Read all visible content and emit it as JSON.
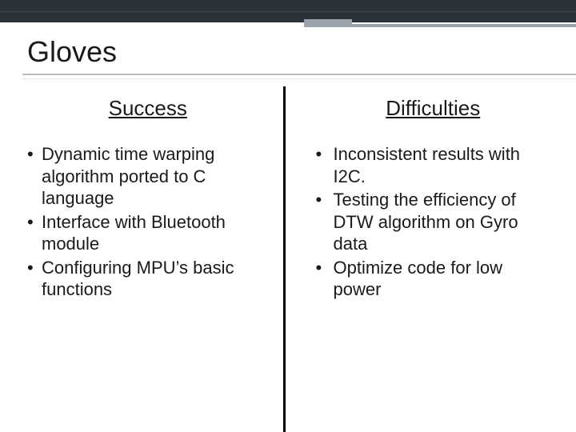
{
  "title": "Gloves",
  "columns": {
    "left": {
      "heading": "Success",
      "items": [
        "Dynamic time warping algorithm ported to C language",
        "Interface with Bluetooth module",
        "Configuring MPU’s basic functions"
      ]
    },
    "right": {
      "heading": "Difficulties",
      "items": [
        " Inconsistent results with I2C.",
        "Testing the efficiency of DTW algorithm on Gyro data",
        "Optimize code for low power"
      ]
    }
  }
}
